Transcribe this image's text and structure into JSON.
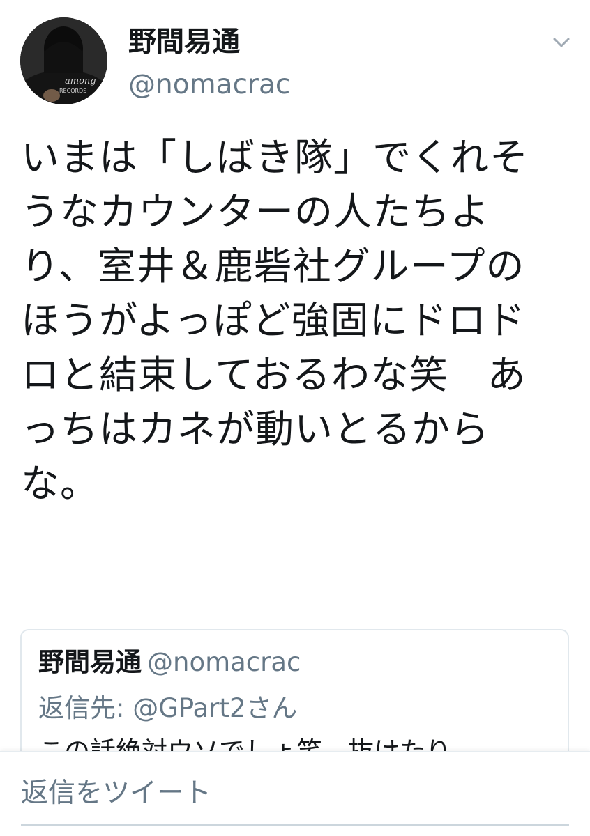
{
  "author": {
    "display_name": "野間易通",
    "handle": "@nomacrac",
    "avatar_shirt_text_1": "among",
    "avatar_shirt_text_2": "RECORDS"
  },
  "tweet": {
    "text": "いまは「しばき隊」でくれそうなカウンターの人たちより、室井＆鹿砦社グループのほうがよっぽど強固にドロドロと結束しておるわな笑　あっちはカネが動いとるからな。"
  },
  "quoted_tweet": {
    "display_name": "野間易通",
    "handle": "@nomacrac",
    "reply_to": "返信先: @GPart2さん",
    "body": "この話絶対ウソでしょ笑　抜けたり"
  },
  "reply_box": {
    "placeholder": "返信をツイート"
  },
  "icons": {
    "caret": "chevron-down-icon"
  },
  "colors": {
    "text_primary": "#14171a",
    "text_secondary": "#657786",
    "border": "#e1e8ed"
  }
}
